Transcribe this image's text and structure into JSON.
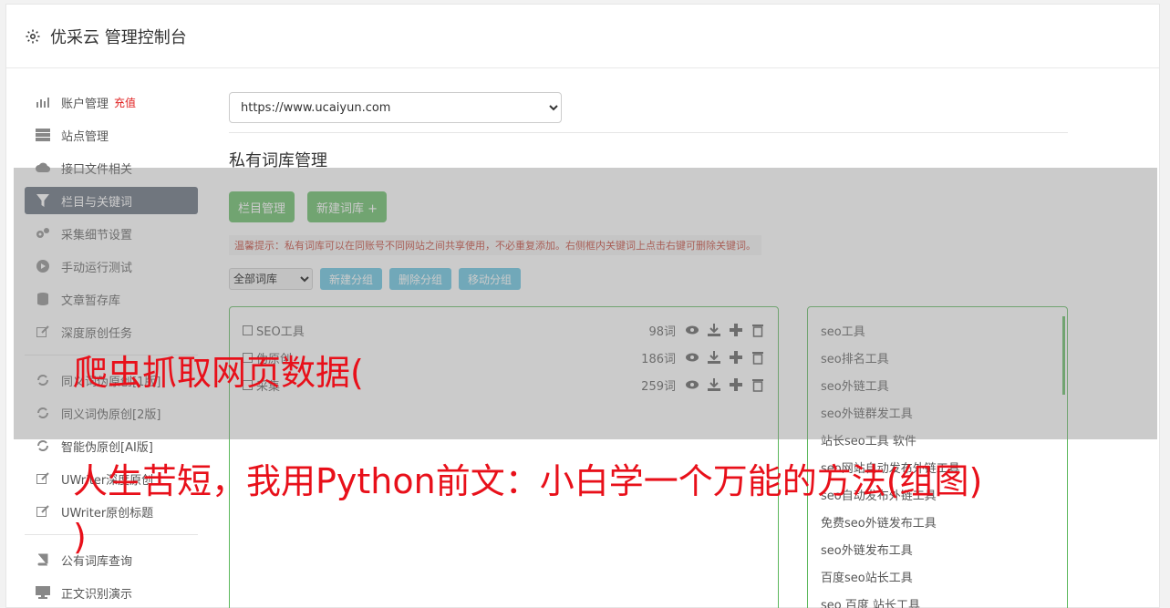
{
  "header": {
    "title": "优采云 管理控制台",
    "icon": "gear-icon"
  },
  "sidebar": {
    "items": [
      {
        "label": "账户管理",
        "badge": "充值",
        "icon": "bar-chart-icon"
      },
      {
        "label": "站点管理",
        "icon": "server-icon"
      },
      {
        "label": "接口文件相关",
        "icon": "cloud-upload-icon"
      },
      {
        "label": "栏目与关键词",
        "icon": "filter-icon",
        "active": true
      },
      {
        "label": "采集细节设置",
        "icon": "cogs-icon"
      },
      {
        "label": "手动运行测试",
        "icon": "play-icon"
      },
      {
        "label": "文章暂存库",
        "icon": "database-icon"
      },
      {
        "label": "深度原创任务",
        "icon": "edit-icon"
      }
    ],
    "items2": [
      {
        "label": "同义词伪原创[1版]",
        "icon": "refresh-icon"
      },
      {
        "label": "同义词伪原创[2版]",
        "icon": "refresh-icon"
      },
      {
        "label": "智能伪原创[AI版]",
        "icon": "refresh-icon"
      },
      {
        "label": "UWriter深度原创",
        "icon": "edit-icon"
      },
      {
        "label": "UWriter原创标题",
        "icon": "edit-icon"
      }
    ],
    "items3": [
      {
        "label": "公有词库查询",
        "icon": "book-icon"
      },
      {
        "label": "正文识别演示",
        "icon": "monitor-icon"
      }
    ]
  },
  "main": {
    "site_select": "https://www.ucaiyun.com",
    "page_title": "私有词库管理",
    "btn_column": "栏目管理",
    "btn_new_lib": "新建词库 +",
    "tip": "温馨提示：私有词库可以在同账号不同网站之间共享使用，不必重复添加。右侧框内关键词上点击右键可删除关键词。",
    "group_select": "全部词库",
    "btn_new_group": "新建分组",
    "btn_del_group": "删除分组",
    "btn_move_group": "移动分组",
    "libraries": [
      {
        "name": "SEO工具",
        "count": "98词"
      },
      {
        "name": "伪原创",
        "count": "186词"
      },
      {
        "name": "采集",
        "count": "259词"
      }
    ],
    "keywords": [
      "seo工具",
      "seo排名工具",
      "seo外链工具",
      "seo外链群发工具",
      "站长seo工具 软件",
      "seo网站自动发布外链工具",
      "seo自动发布外链工具",
      "免费seo外链发布工具",
      "seo外链发布工具",
      "百度seo站长工具",
      "seo 百度 站长工具"
    ]
  },
  "overlay": {
    "line1": "爬虫抓取网页数据(",
    "line2": "人生苦短，我用Python前文：小白学一个万能的方法(组图)",
    "line3": ")"
  },
  "colors": {
    "accent_green": "#5cb85c",
    "accent_blue": "#5bc0de",
    "active_nav": "#5a6474",
    "overlay_text": "#e8101a"
  }
}
